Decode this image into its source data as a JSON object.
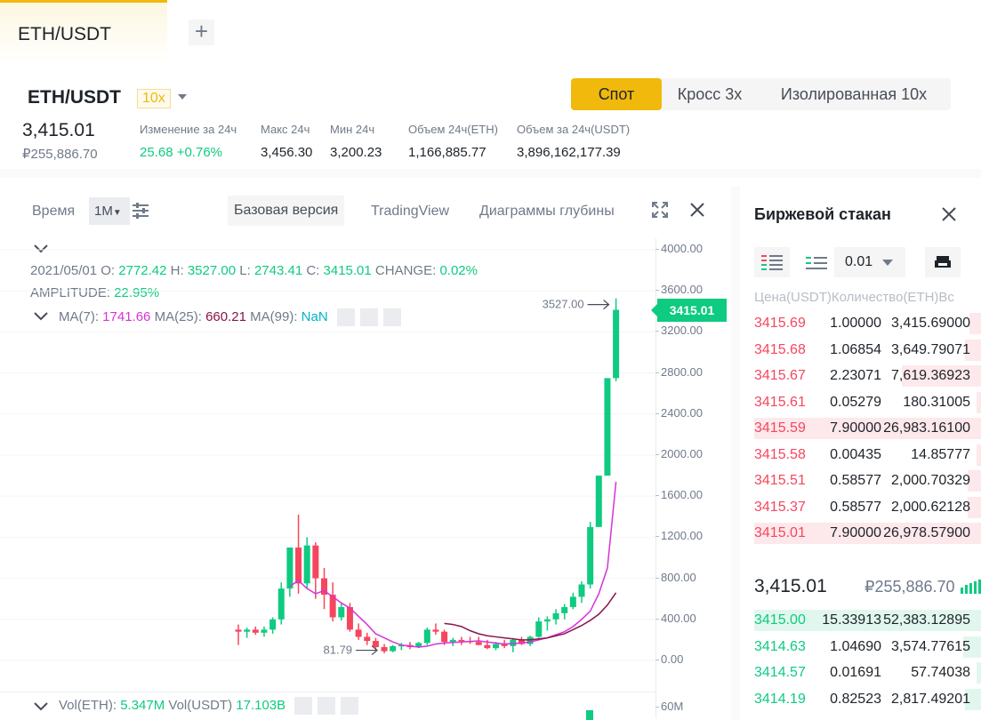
{
  "tabs": [
    {
      "label": "ETH/USDT",
      "active": true
    }
  ],
  "ticker": {
    "pair": "ETH/USDT",
    "leverage": "10x",
    "last_price": "3,415.01",
    "last_price_rub": "₽255,886.70",
    "stats": [
      {
        "label": "Изменение за 24ч",
        "value": "25.68 +0.76%",
        "color": "green"
      },
      {
        "label": "Макс 24ч",
        "value": "3,456.30"
      },
      {
        "label": "Мин 24ч",
        "value": "3,200.23"
      },
      {
        "label": "Объем 24ч(ETH)",
        "value": "1,166,885.77"
      },
      {
        "label": "Объем за 24ч(USDT)",
        "value": "3,896,162,177.39"
      }
    ],
    "modes": [
      {
        "label": "Спот",
        "active": true
      },
      {
        "label": "Кросс 3x"
      },
      {
        "label": "Изолированная 10x"
      }
    ]
  },
  "chart_toolbar": {
    "time_label": "Время",
    "interval": "1M",
    "views": [
      "Базовая версия",
      "TradingView",
      "Диаграммы глубины"
    ]
  },
  "legend": {
    "date": "2021/05/01",
    "o_label": "O:",
    "o": "2772.42",
    "h_label": "H:",
    "h": "3527.00",
    "l_label": "L:",
    "l": "2743.41",
    "c_label": "C:",
    "c": "3415.01",
    "change_label": "CHANGE:",
    "change": "0.02%",
    "amp_label": "AMPLITUDE:",
    "amplitude": "22.95%",
    "ma7_label": "MA(7):",
    "ma7": "1741.66",
    "ma25_label": "MA(25):",
    "ma25": "660.21",
    "ma99_label": "MA(99):",
    "ma99": "NaN",
    "vol_eth_label": "Vol(ETH):",
    "vol_eth": "5.347M",
    "vol_usdt_label": "Vol(USDT)",
    "vol_usdt": "17.103B"
  },
  "colors": {
    "up": "#0ecb81",
    "down": "#f6465d",
    "ma7": "#d733d7",
    "ma25": "#8a1449",
    "accent": "#f0b90b"
  },
  "chart_data": {
    "type": "candlestick",
    "ylim": [
      -150,
      4150
    ],
    "y_ticks": [
      "4000.00",
      "3600.00",
      "3200.00",
      "2800.00",
      "2400.00",
      "2000.00",
      "1600.00",
      "1200.00",
      "800.00",
      "400.00",
      "0.00"
    ],
    "volume_tick": "60M",
    "last_label": "3415.01",
    "last_value": 3415.01,
    "max_label": "3527.00",
    "max_value": 3527,
    "min_label": "81.79",
    "min_value": 81.79,
    "candles": [
      [
        300,
        350,
        150,
        280
      ],
      [
        280,
        320,
        220,
        300
      ],
      [
        300,
        330,
        250,
        270
      ],
      [
        270,
        330,
        230,
        300
      ],
      [
        300,
        420,
        260,
        400
      ],
      [
        400,
        760,
        350,
        700
      ],
      [
        700,
        1000,
        620,
        1100
      ],
      [
        1100,
        1420,
        650,
        750
      ],
      [
        750,
        1200,
        700,
        1120
      ],
      [
        1120,
        1150,
        600,
        800
      ],
      [
        800,
        900,
        500,
        640
      ],
      [
        640,
        760,
        380,
        420
      ],
      [
        420,
        560,
        390,
        520
      ],
      [
        520,
        560,
        280,
        300
      ],
      [
        300,
        360,
        200,
        230
      ],
      [
        230,
        270,
        150,
        190
      ],
      [
        190,
        220,
        100,
        130
      ],
      [
        130,
        160,
        70,
        90
      ],
      [
        90,
        150,
        80,
        140
      ],
      [
        140,
        170,
        100,
        150
      ],
      [
        150,
        180,
        110,
        130
      ],
      [
        130,
        180,
        120,
        170
      ],
      [
        170,
        320,
        150,
        300
      ],
      [
        300,
        360,
        250,
        280
      ],
      [
        280,
        300,
        150,
        180
      ],
      [
        180,
        220,
        140,
        200
      ],
      [
        200,
        230,
        150,
        190
      ],
      [
        190,
        230,
        160,
        180
      ],
      [
        180,
        230,
        150,
        150
      ],
      [
        150,
        200,
        110,
        120
      ],
      [
        120,
        180,
        100,
        160
      ],
      [
        160,
        200,
        120,
        140
      ],
      [
        140,
        220,
        80,
        200
      ],
      [
        200,
        230,
        150,
        160
      ],
      [
        160,
        240,
        140,
        230
      ],
      [
        230,
        420,
        220,
        380
      ],
      [
        380,
        430,
        290,
        400
      ],
      [
        400,
        500,
        350,
        460
      ],
      [
        460,
        550,
        400,
        520
      ],
      [
        520,
        660,
        500,
        620
      ],
      [
        620,
        770,
        560,
        740
      ],
      [
        740,
        1350,
        700,
        1300
      ],
      [
        1300,
        1800,
        1300,
        1800
      ],
      [
        1800,
        2700,
        1800,
        2750
      ],
      [
        2750,
        3527,
        2720,
        3415
      ]
    ],
    "ma7": [
      null,
      null,
      null,
      null,
      null,
      null,
      720,
      780,
      700,
      650,
      680,
      620,
      560,
      510,
      430,
      350,
      260,
      220,
      180,
      150,
      140,
      130,
      140,
      160,
      170,
      175,
      180,
      185,
      190,
      180,
      170,
      160,
      165,
      170,
      180,
      200,
      220,
      250,
      280,
      330,
      400,
      480,
      650,
      900,
      1740
    ],
    "ma25": [
      null,
      null,
      null,
      null,
      null,
      null,
      null,
      null,
      null,
      null,
      null,
      null,
      null,
      null,
      null,
      null,
      null,
      null,
      null,
      null,
      null,
      null,
      null,
      null,
      360,
      350,
      330,
      290,
      260,
      240,
      230,
      220,
      210,
      200,
      200,
      210,
      220,
      240,
      260,
      300,
      340,
      390,
      450,
      540,
      660
    ]
  },
  "orderbook": {
    "title": "Биржевой стакан",
    "precision": "0.01",
    "header": "Цена(USDT)Количество(ETH)Вс",
    "asks": [
      {
        "price": "3415.69",
        "qty": "1.00000",
        "total": "3,415.69000",
        "depth": 0.05
      },
      {
        "price": "3415.68",
        "qty": "1.06854",
        "total": "3,649.79071",
        "depth": 0.07
      },
      {
        "price": "3415.67",
        "qty": "2.23071",
        "total": "7,619.36923",
        "depth": 0.35
      },
      {
        "price": "3415.61",
        "qty": "0.05279",
        "total": "180.31005",
        "depth": 0.02
      },
      {
        "price": "3415.59",
        "qty": "7.90000",
        "total": "26,983.16100",
        "depth": 1
      },
      {
        "price": "3415.58",
        "qty": "0.00435",
        "total": "14.85777",
        "depth": 0.02
      },
      {
        "price": "3415.51",
        "qty": "0.58577",
        "total": "2,000.70329",
        "depth": 0.06
      },
      {
        "price": "3415.37",
        "qty": "0.58577",
        "total": "2,000.62128",
        "depth": 0.06
      },
      {
        "price": "3415.01",
        "qty": "7.90000",
        "total": "26,978.57900",
        "depth": 1
      }
    ],
    "mid_price": "3,415.01",
    "mid_rub": "₽255,886.70",
    "bids": [
      {
        "price": "3415.00",
        "qty": "15.33913",
        "total": "52,383.12895",
        "depth": 1
      },
      {
        "price": "3414.63",
        "qty": "1.04690",
        "total": "3,574.77615",
        "depth": 0.08
      },
      {
        "price": "3414.57",
        "qty": "0.01691",
        "total": "57.74038",
        "depth": 0.02
      },
      {
        "price": "3414.19",
        "qty": "0.82523",
        "total": "2,817.49201",
        "depth": 0.07
      }
    ]
  }
}
